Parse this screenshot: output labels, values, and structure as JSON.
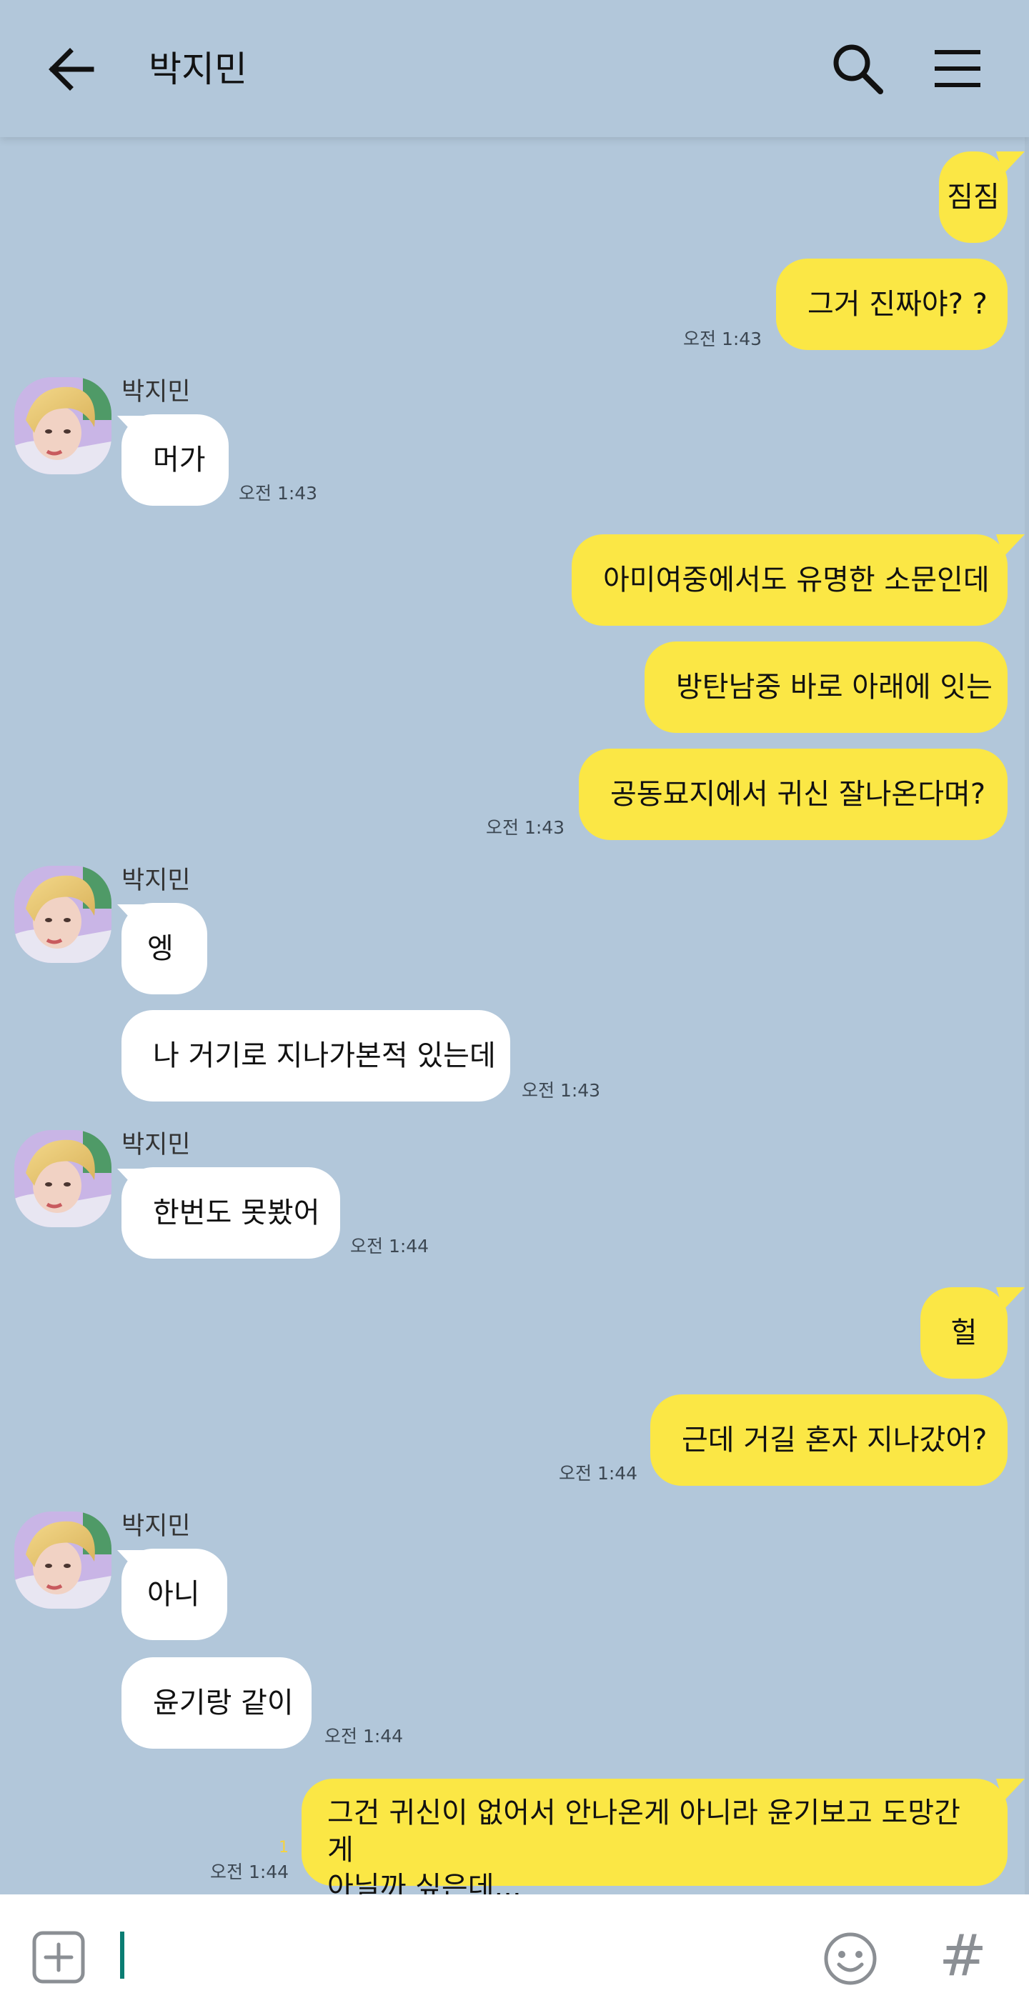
{
  "header": {
    "title": "박지민"
  },
  "messages": [
    {
      "side": "me",
      "text": "짐짐"
    },
    {
      "side": "me",
      "text": "그거 진짜야? ?",
      "time": "오전 1:43"
    },
    {
      "side": "them",
      "sender": "박지민",
      "text": "머가",
      "time": "오전 1:43"
    },
    {
      "side": "me",
      "text": "아미여중에서도 유명한 소문인데"
    },
    {
      "side": "me",
      "text": "방탄남중 바로 아래에 잇는"
    },
    {
      "side": "me",
      "text": "공동묘지에서 귀신 잘나온다며?",
      "time": "오전 1:43"
    },
    {
      "side": "them",
      "sender": "박지민",
      "text": "엥"
    },
    {
      "side": "them",
      "text": "나 거기로 지나가본적 있는데",
      "time": "오전 1:43"
    },
    {
      "side": "them",
      "sender": "박지민",
      "text": "한번도 못봤어",
      "time": "오전 1:44"
    },
    {
      "side": "me",
      "text": "헐"
    },
    {
      "side": "me",
      "text": "근데 거길 혼자 지나갔어?",
      "time": "오전 1:44"
    },
    {
      "side": "them",
      "sender": "박지민",
      "text": "아니"
    },
    {
      "side": "them",
      "text": "윤기랑 같이",
      "time": "오전 1:44"
    },
    {
      "side": "me",
      "line1": "그건 귀신이 없어서 안나온게 아니라 윤기보고 도망간게",
      "line2": "아닐까 싶은데...",
      "time": "오전 1:44",
      "unread": "1"
    }
  ],
  "colors": {
    "background": "#b2c7da",
    "my_bubble": "#fbe745",
    "their_bubble": "#ffffff",
    "caret": "#0b7d73"
  },
  "icons": {
    "back": "arrow-left-icon",
    "search": "search-icon",
    "menu": "hamburger-menu-icon",
    "plus": "plus-square-icon",
    "emoji": "smiley-icon",
    "hash": "hash-icon"
  },
  "input": {
    "value": ""
  }
}
